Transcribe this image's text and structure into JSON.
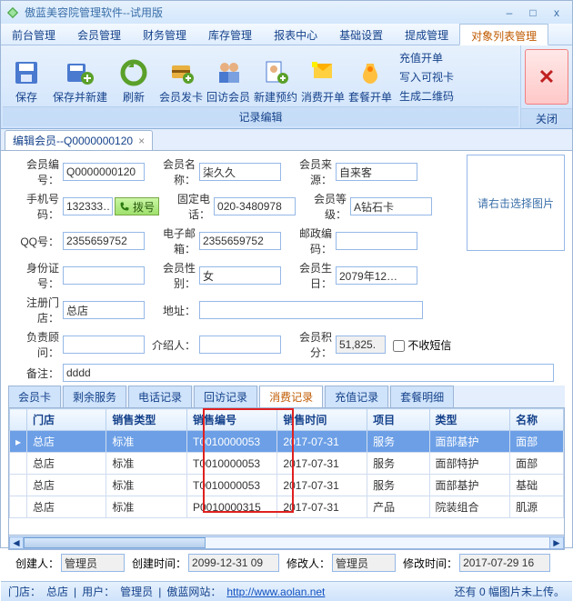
{
  "window": {
    "title": "傲蓝美容院管理软件--试用版"
  },
  "menu": {
    "items": [
      "前台管理",
      "会员管理",
      "财务管理",
      "库存管理",
      "报表中心",
      "基础设置",
      "提成管理",
      "对象列表管理"
    ],
    "active_index": 7
  },
  "ribbon": {
    "buttons": [
      {
        "label": "保存"
      },
      {
        "label": "保存并新建"
      },
      {
        "label": "刷新"
      },
      {
        "label": "会员发卡"
      },
      {
        "label": "回访会员"
      },
      {
        "label": "新建预约"
      },
      {
        "label": "消费开单"
      },
      {
        "label": "套餐开单"
      }
    ],
    "text_actions": [
      "充值开单",
      "写入可视卡",
      "生成二维码"
    ],
    "group1_label": "记录编辑",
    "close_label": "关闭"
  },
  "doc_tab": {
    "title": "编辑会员--Q0000000120"
  },
  "form": {
    "fields": {
      "member_no": {
        "label": "会员编号：",
        "value": "Q0000000120"
      },
      "member_name": {
        "label": "会员名称：",
        "value": "柒久久"
      },
      "member_source": {
        "label": "会员来源：",
        "value": "自来客"
      },
      "mobile": {
        "label": "手机号码：",
        "value": "132333…"
      },
      "dial": {
        "label": "拨号"
      },
      "tel": {
        "label": "固定电话：",
        "value": "020-3480978"
      },
      "member_level": {
        "label": "会员等级：",
        "value": "A钻石卡"
      },
      "qq": {
        "label": "QQ号：",
        "value": "2355659752"
      },
      "email": {
        "label": "电子邮箱：",
        "value": "2355659752"
      },
      "postcode": {
        "label": "邮政编码：",
        "value": ""
      },
      "id_card": {
        "label": "身份证号：",
        "value": ""
      },
      "gender": {
        "label": "会员性别：",
        "value": "女"
      },
      "birthday": {
        "label": "会员生日：",
        "value": "2079年12…"
      },
      "reg_store": {
        "label": "注册门店：",
        "value": "总店"
      },
      "address": {
        "label": "地址：",
        "value": ""
      },
      "consultant": {
        "label": "负责顾问：",
        "value": ""
      },
      "referrer": {
        "label": "介绍人：",
        "value": ""
      },
      "points": {
        "label": "会员积分：",
        "value": "51,825."
      },
      "no_sms": {
        "label": "不收短信",
        "checked": false
      },
      "remark": {
        "label": "备注：",
        "value": "dddd"
      }
    },
    "image_placeholder": "请右击选择图片"
  },
  "inner_tabs": {
    "items": [
      "会员卡",
      "剩余服务",
      "电话记录",
      "回访记录",
      "消费记录",
      "充值记录",
      "套餐明细"
    ],
    "active_index": 4
  },
  "grid": {
    "columns": [
      "门店",
      "销售类型",
      "销售编号",
      "销售时间",
      "项目",
      "类型",
      "名称"
    ],
    "rows": [
      {
        "store": "总店",
        "sale_type": "标准",
        "sale_no": "T0010000053",
        "sale_time": "2017-07-31",
        "project": "服务",
        "kind": "面部基护",
        "name": "面部",
        "selected": true
      },
      {
        "store": "总店",
        "sale_type": "标准",
        "sale_no": "T0010000053",
        "sale_time": "2017-07-31",
        "project": "服务",
        "kind": "面部特护",
        "name": "面部"
      },
      {
        "store": "总店",
        "sale_type": "标准",
        "sale_no": "T0010000053",
        "sale_time": "2017-07-31",
        "project": "服务",
        "kind": "面部基护",
        "name": "基础"
      },
      {
        "store": "总店",
        "sale_type": "标准",
        "sale_no": "P0010000315",
        "sale_time": "2017-07-31",
        "project": "产品",
        "kind": "院装组合",
        "name": "肌源"
      }
    ]
  },
  "footer": {
    "creator": {
      "label": "创建人：",
      "value": "管理员"
    },
    "create_time": {
      "label": "创建时间：",
      "value": "2099-12-31 09"
    },
    "modifier": {
      "label": "修改人：",
      "value": "管理员"
    },
    "modify_time": {
      "label": "修改时间：",
      "value": "2017-07-29 16"
    }
  },
  "status": {
    "store_label": "门店：",
    "store_value": "总店",
    "user_label": "用户：",
    "user_value": "管理员",
    "site_label": "傲蓝网站：",
    "site_value": "http://www.aolan.net",
    "upload_msg": "还有 0 幅图片未上传。"
  }
}
